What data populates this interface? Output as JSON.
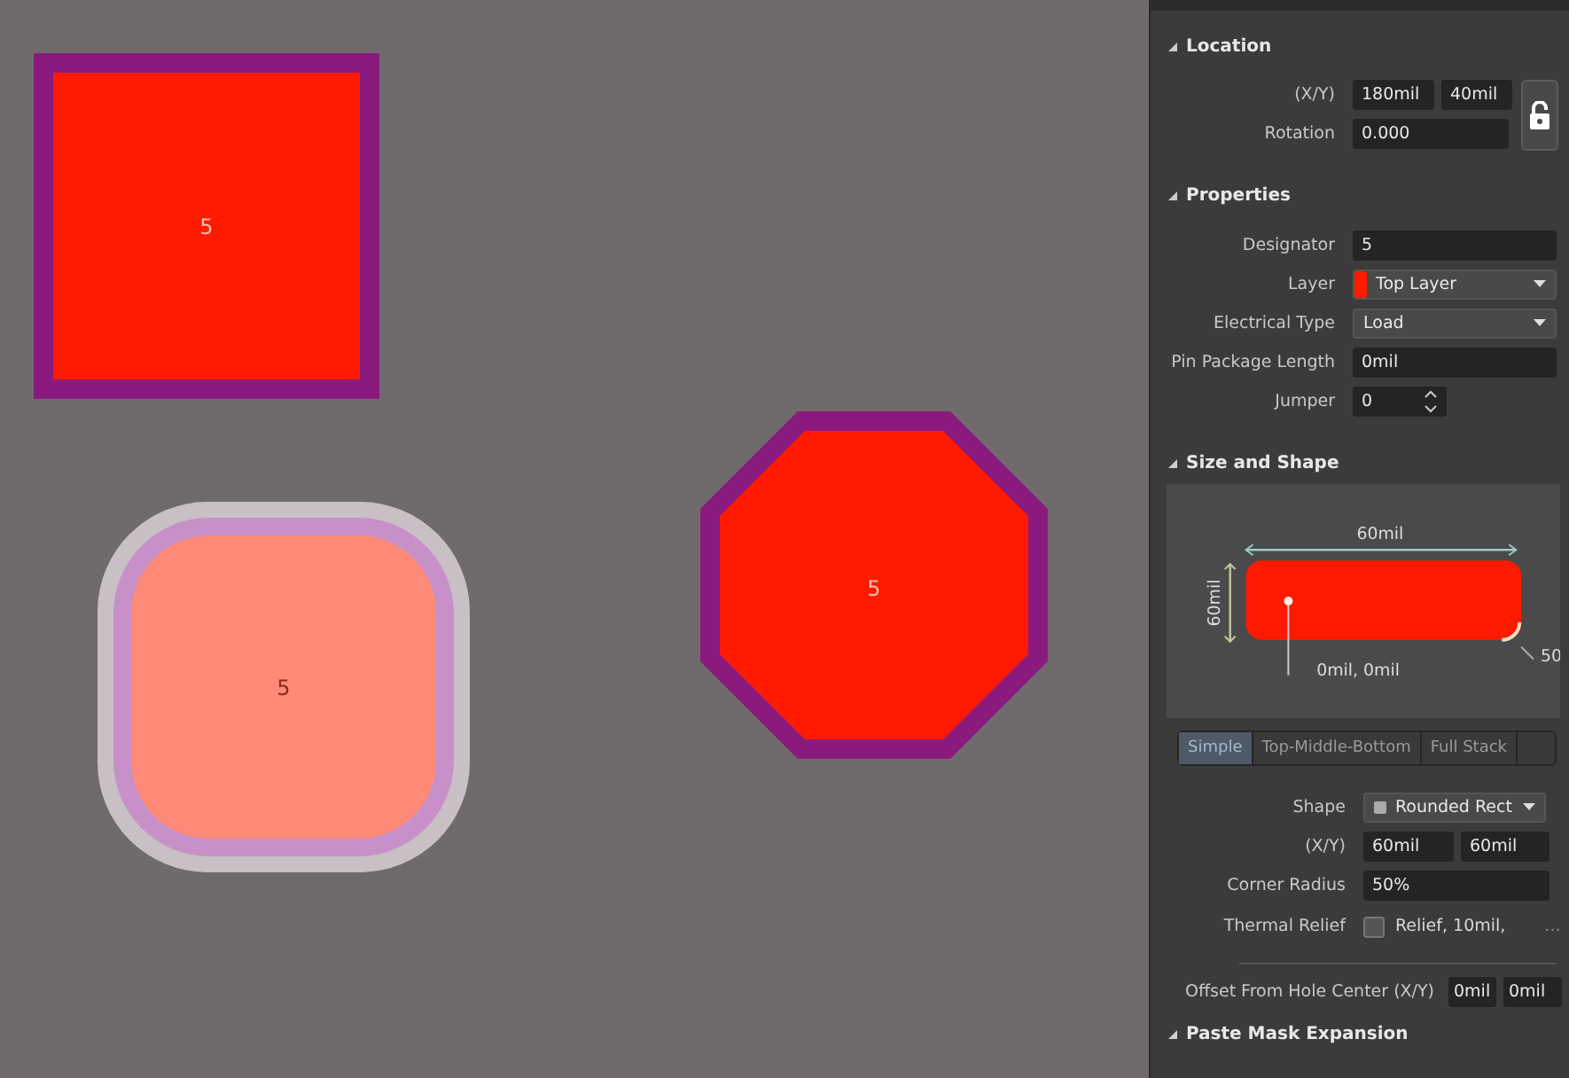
{
  "pads": [
    {
      "kind": "square",
      "label": "5"
    },
    {
      "kind": "rounded",
      "label": "5"
    },
    {
      "kind": "octagon",
      "label": "5"
    }
  ],
  "location": {
    "title": "Location",
    "expanded": true,
    "xy_label": "(X/Y)",
    "x": "180mil",
    "y": "40mil",
    "locked": false,
    "rotation_label": "Rotation",
    "rotation": "0.000"
  },
  "properties": {
    "title": "Properties",
    "expanded": true,
    "rows": [
      {
        "kind": "field",
        "label": "Designator",
        "value": "5"
      },
      {
        "kind": "dropdown",
        "label": "Layer",
        "value": "Top Layer",
        "color": "#ff1a00"
      },
      {
        "kind": "dropdown",
        "label": "Electrical Type",
        "value": "Load"
      },
      {
        "kind": "field",
        "label": "Pin Package Length",
        "value": "0mil"
      },
      {
        "kind": "spinner",
        "label": "Jumper",
        "value": "0"
      }
    ]
  },
  "size_and_shape": {
    "title": "Size and Shape",
    "expanded": true,
    "preview": {
      "width_label": "60mil",
      "height_label": "60mil",
      "offset_label": "0mil, 0mil",
      "radius_label": "50"
    },
    "tabs": [
      {
        "label": "Simple",
        "selected": true
      },
      {
        "label": "Top-Middle-Bottom",
        "selected": false
      },
      {
        "label": "Full Stack",
        "selected": false
      }
    ],
    "shape_label": "Shape",
    "shape": "Rounded Rect",
    "xy_label": "(X/Y)",
    "x": "60mil",
    "y": "60mil",
    "corner_label": "Corner Radius",
    "corner": "50%",
    "thermal_label": "Thermal Relief",
    "thermal_checked": false,
    "thermal_value": "Relief, 10mil,",
    "thermal_more": "...",
    "offset_label": "Offset From Hole Center (X/Y)",
    "offset_x": "0mil",
    "offset_y": "0mil"
  },
  "paste_mask": {
    "title": "Paste Mask Expansion",
    "expanded": true
  }
}
